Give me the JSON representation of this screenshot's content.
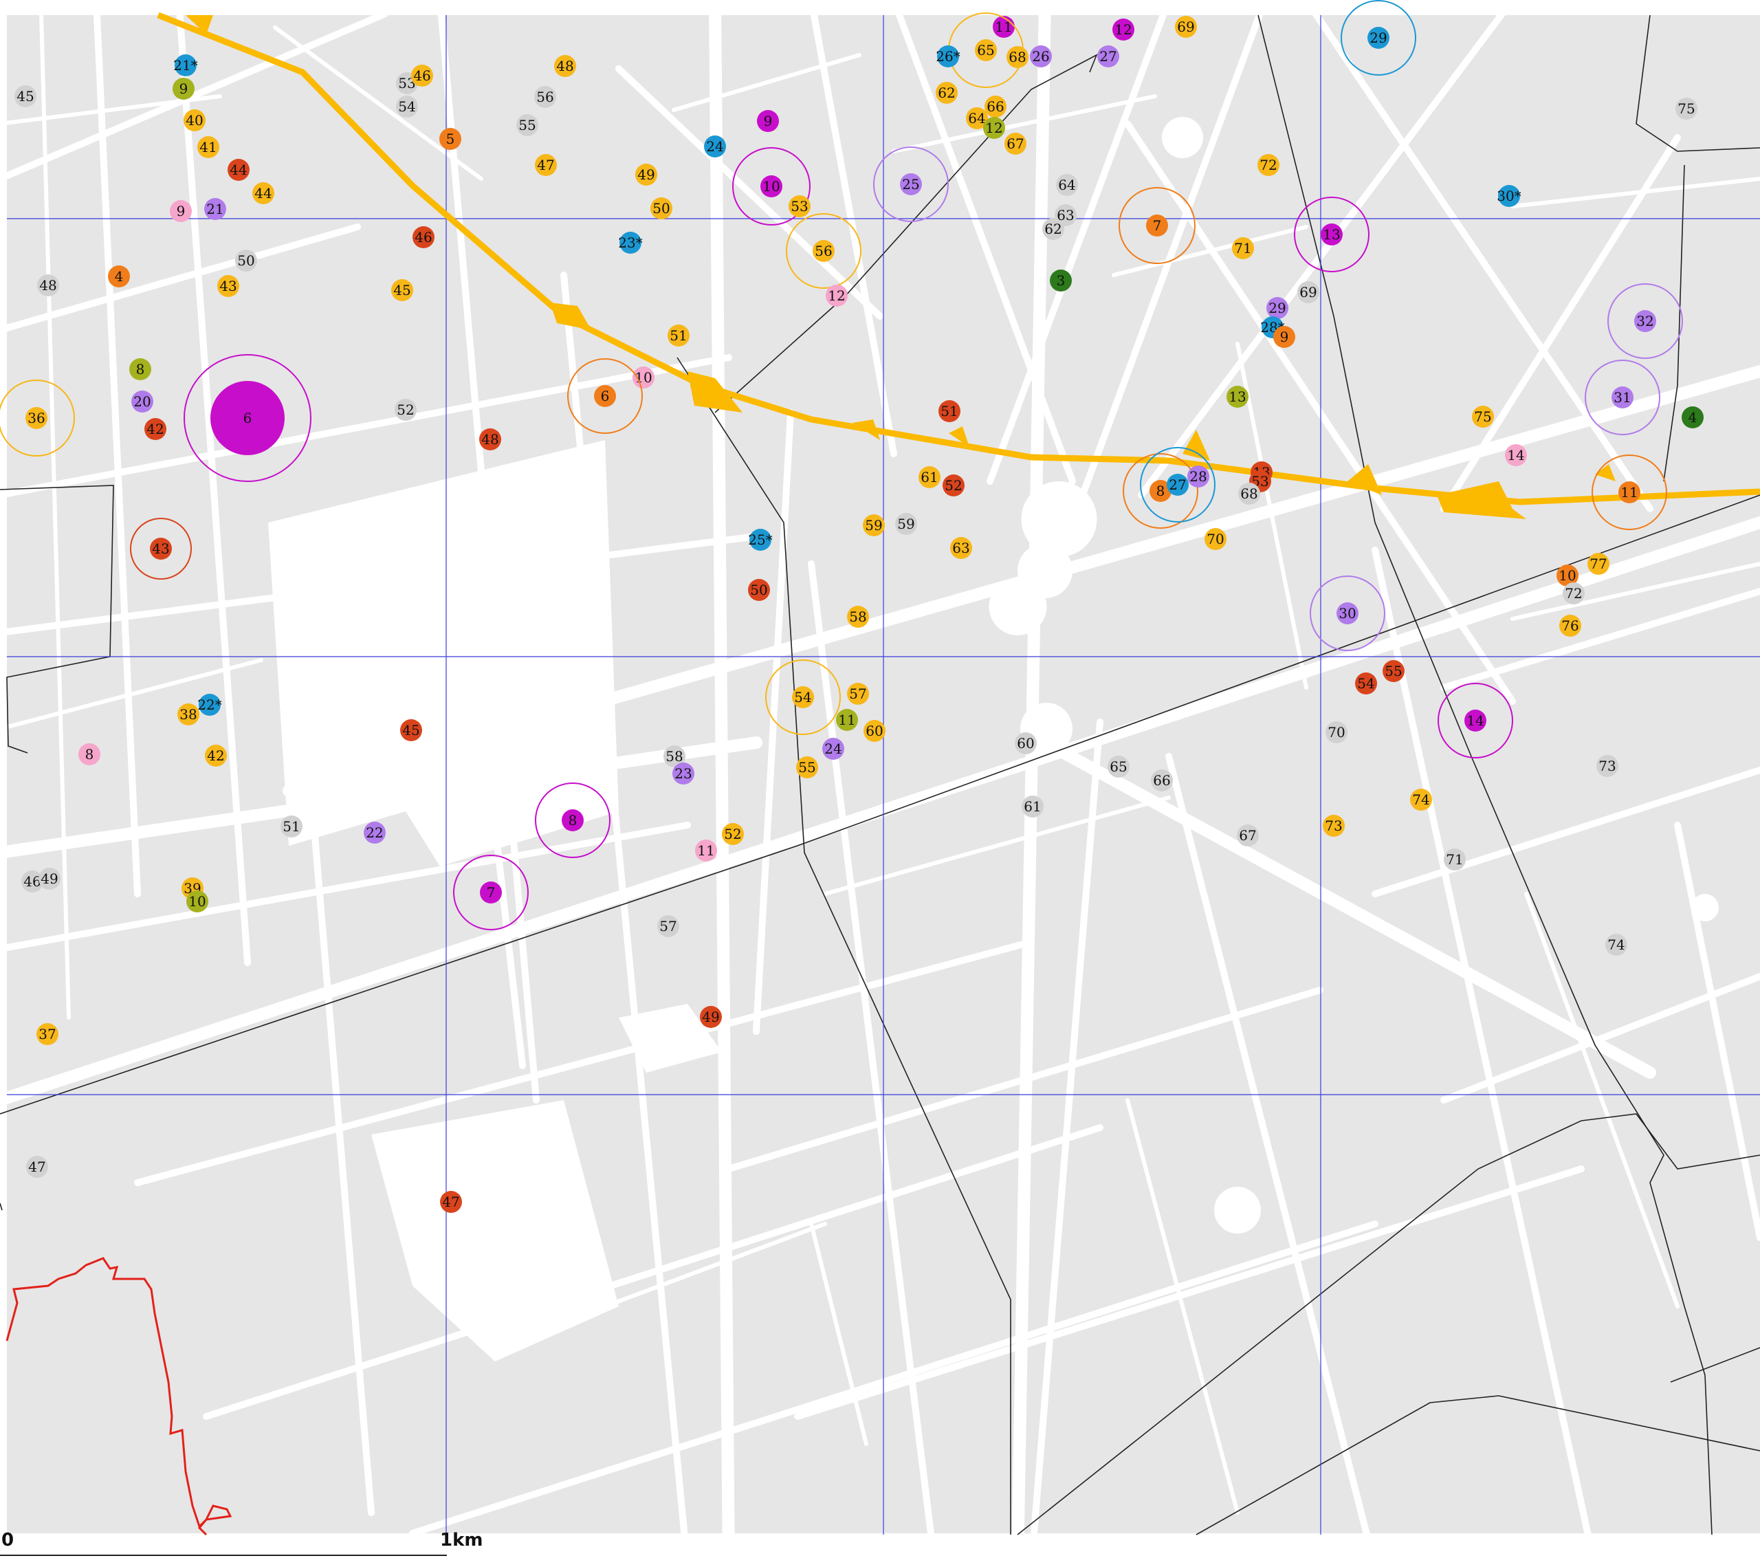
{
  "colors": {
    "background": "#ffffff",
    "block": "#e6e6e6",
    "street": "#ffffff",
    "grid_line": "#3b3bdc",
    "boundary_line": "#222222",
    "route": "#fbb900",
    "red_outline": "#e32119",
    "categories": {
      "gray": "#d1d1d1",
      "yellow": "#f7b718",
      "orange": "#f07d1a",
      "red": "#d9441c",
      "magenta": "#c70ecb",
      "violet": "#b07bea",
      "pink": "#f6a5cb",
      "blue": "#1b98d3",
      "olive": "#a4b21e",
      "green": "#2c7a1b"
    }
  },
  "scale_bar": {
    "start_label": "0",
    "end_label": "1km"
  },
  "markers": [
    {
      "label": "45",
      "cat": "gray"
    },
    {
      "label": "21*",
      "cat": "blue"
    },
    {
      "label": "9",
      "cat": "olive"
    },
    {
      "label": "40",
      "cat": "yellow"
    },
    {
      "label": "41",
      "cat": "yellow"
    },
    {
      "label": "44",
      "cat": "red"
    },
    {
      "label": "44",
      "cat": "yellow"
    },
    {
      "label": "9",
      "cat": "pink"
    },
    {
      "label": "21",
      "cat": "violet"
    },
    {
      "label": "50",
      "cat": "gray"
    },
    {
      "label": "48",
      "cat": "gray"
    },
    {
      "label": "4",
      "cat": "orange"
    },
    {
      "label": "43",
      "cat": "yellow"
    },
    {
      "label": "53",
      "cat": "gray"
    },
    {
      "label": "46",
      "cat": "yellow"
    },
    {
      "label": "54",
      "cat": "gray"
    },
    {
      "label": "48",
      "cat": "yellow"
    },
    {
      "label": "56",
      "cat": "gray"
    },
    {
      "label": "55",
      "cat": "gray"
    },
    {
      "label": "5",
      "cat": "orange"
    },
    {
      "label": "47",
      "cat": "yellow"
    },
    {
      "label": "46",
      "cat": "red"
    },
    {
      "label": "45",
      "cat": "yellow"
    },
    {
      "label": "8",
      "cat": "olive"
    },
    {
      "label": "20",
      "cat": "violet"
    },
    {
      "label": "42",
      "cat": "red"
    },
    {
      "label": "36",
      "cat": "yellow",
      "ring": true
    },
    {
      "label": "6",
      "cat": "magenta",
      "big": true
    },
    {
      "label": "52",
      "cat": "gray"
    },
    {
      "label": "48",
      "cat": "red"
    },
    {
      "label": "43",
      "cat": "red",
      "ring": true
    },
    {
      "label": "9",
      "cat": "magenta"
    },
    {
      "label": "24",
      "cat": "blue"
    },
    {
      "label": "49",
      "cat": "yellow"
    },
    {
      "label": "10",
      "cat": "magenta",
      "ring": true
    },
    {
      "label": "53",
      "cat": "yellow"
    },
    {
      "label": "50",
      "cat": "yellow"
    },
    {
      "label": "23*",
      "cat": "blue"
    },
    {
      "label": "56",
      "cat": "yellow",
      "ring": true
    },
    {
      "label": "12",
      "cat": "pink"
    },
    {
      "label": "51",
      "cat": "yellow"
    },
    {
      "label": "10",
      "cat": "pink"
    },
    {
      "label": "6",
      "cat": "orange",
      "ring": true
    },
    {
      "label": "25*",
      "cat": "blue"
    },
    {
      "label": "50",
      "cat": "red"
    },
    {
      "label": "59",
      "cat": "yellow"
    },
    {
      "label": "59",
      "cat": "gray"
    },
    {
      "label": "58",
      "cat": "yellow"
    },
    {
      "label": "61",
      "cat": "yellow"
    },
    {
      "label": "52",
      "cat": "red"
    },
    {
      "label": "51",
      "cat": "red"
    },
    {
      "label": "63",
      "cat": "yellow"
    },
    {
      "label": "11",
      "cat": "magenta"
    },
    {
      "label": "65",
      "cat": "yellow",
      "ring": true
    },
    {
      "label": "26*",
      "cat": "blue"
    },
    {
      "label": "68",
      "cat": "yellow"
    },
    {
      "label": "26",
      "cat": "violet"
    },
    {
      "label": "62",
      "cat": "yellow"
    },
    {
      "label": "66",
      "cat": "yellow"
    },
    {
      "label": "64",
      "cat": "yellow"
    },
    {
      "label": "12",
      "cat": "olive"
    },
    {
      "label": "67",
      "cat": "yellow"
    },
    {
      "label": "25",
      "cat": "violet",
      "ring": true
    },
    {
      "label": "12",
      "cat": "magenta"
    },
    {
      "label": "69",
      "cat": "yellow"
    },
    {
      "label": "27",
      "cat": "violet"
    },
    {
      "label": "64",
      "cat": "gray"
    },
    {
      "label": "63",
      "cat": "gray"
    },
    {
      "label": "62",
      "cat": "gray"
    },
    {
      "label": "3",
      "cat": "green"
    },
    {
      "label": "7",
      "cat": "orange",
      "ring": true
    },
    {
      "label": "71",
      "cat": "yellow"
    },
    {
      "label": "72",
      "cat": "yellow"
    },
    {
      "label": "13",
      "cat": "magenta",
      "ring": true
    },
    {
      "label": "29",
      "cat": "blue",
      "ring": true
    },
    {
      "label": "69",
      "cat": "gray"
    },
    {
      "label": "29",
      "cat": "violet"
    },
    {
      "label": "28*",
      "cat": "blue"
    },
    {
      "label": "9",
      "cat": "orange"
    },
    {
      "label": "13",
      "cat": "olive"
    },
    {
      "label": "8",
      "cat": "orange",
      "ring": true
    },
    {
      "label": "27",
      "cat": "blue",
      "ring": true
    },
    {
      "label": "28",
      "cat": "violet"
    },
    {
      "label": "13",
      "cat": "red"
    },
    {
      "label": "53",
      "cat": "red"
    },
    {
      "label": "68",
      "cat": "gray"
    },
    {
      "label": "70",
      "cat": "yellow"
    },
    {
      "label": "75",
      "cat": "gray"
    },
    {
      "label": "30*",
      "cat": "blue"
    },
    {
      "label": "32",
      "cat": "violet",
      "ring": true
    },
    {
      "label": "31",
      "cat": "violet",
      "ring": true
    },
    {
      "label": "4",
      "cat": "green"
    },
    {
      "label": "75",
      "cat": "yellow"
    },
    {
      "label": "14",
      "cat": "pink"
    },
    {
      "label": "11",
      "cat": "orange",
      "ring": true
    },
    {
      "label": "30",
      "cat": "violet",
      "ring": true
    },
    {
      "label": "10",
      "cat": "orange"
    },
    {
      "label": "77",
      "cat": "yellow"
    },
    {
      "label": "72",
      "cat": "gray"
    },
    {
      "label": "76",
      "cat": "yellow"
    },
    {
      "label": "22*",
      "cat": "blue"
    },
    {
      "label": "38",
      "cat": "yellow"
    },
    {
      "label": "8",
      "cat": "pink"
    },
    {
      "label": "42",
      "cat": "yellow"
    },
    {
      "label": "45",
      "cat": "red"
    },
    {
      "label": "51",
      "cat": "gray"
    },
    {
      "label": "22",
      "cat": "violet"
    },
    {
      "label": "46",
      "cat": "gray"
    },
    {
      "label": "49",
      "cat": "gray"
    },
    {
      "label": "39",
      "cat": "yellow"
    },
    {
      "label": "10",
      "cat": "olive"
    },
    {
      "label": "37",
      "cat": "yellow"
    },
    {
      "label": "8",
      "cat": "magenta",
      "ring": true
    },
    {
      "label": "7",
      "cat": "magenta",
      "ring": true
    },
    {
      "label": "58",
      "cat": "gray"
    },
    {
      "label": "23",
      "cat": "violet"
    },
    {
      "label": "54",
      "cat": "yellow",
      "ring": true
    },
    {
      "label": "57",
      "cat": "yellow"
    },
    {
      "label": "11",
      "cat": "olive"
    },
    {
      "label": "60",
      "cat": "yellow"
    },
    {
      "label": "24",
      "cat": "violet"
    },
    {
      "label": "55",
      "cat": "yellow"
    },
    {
      "label": "52",
      "cat": "yellow"
    },
    {
      "label": "11",
      "cat": "pink"
    },
    {
      "label": "57",
      "cat": "gray"
    },
    {
      "label": "49",
      "cat": "red"
    },
    {
      "label": "60",
      "cat": "gray"
    },
    {
      "label": "61",
      "cat": "gray"
    },
    {
      "label": "65",
      "cat": "gray"
    },
    {
      "label": "66",
      "cat": "gray"
    },
    {
      "label": "67",
      "cat": "gray"
    },
    {
      "label": "54",
      "cat": "red"
    },
    {
      "label": "55",
      "cat": "red"
    },
    {
      "label": "70",
      "cat": "gray"
    },
    {
      "label": "73",
      "cat": "yellow"
    },
    {
      "label": "14",
      "cat": "magenta",
      "ring": true
    },
    {
      "label": "74",
      "cat": "yellow"
    },
    {
      "label": "71",
      "cat": "gray"
    },
    {
      "label": "73",
      "cat": "gray"
    },
    {
      "label": "74",
      "cat": "gray"
    },
    {
      "label": "47",
      "cat": "gray"
    },
    {
      "label": "47",
      "cat": "red"
    }
  ]
}
